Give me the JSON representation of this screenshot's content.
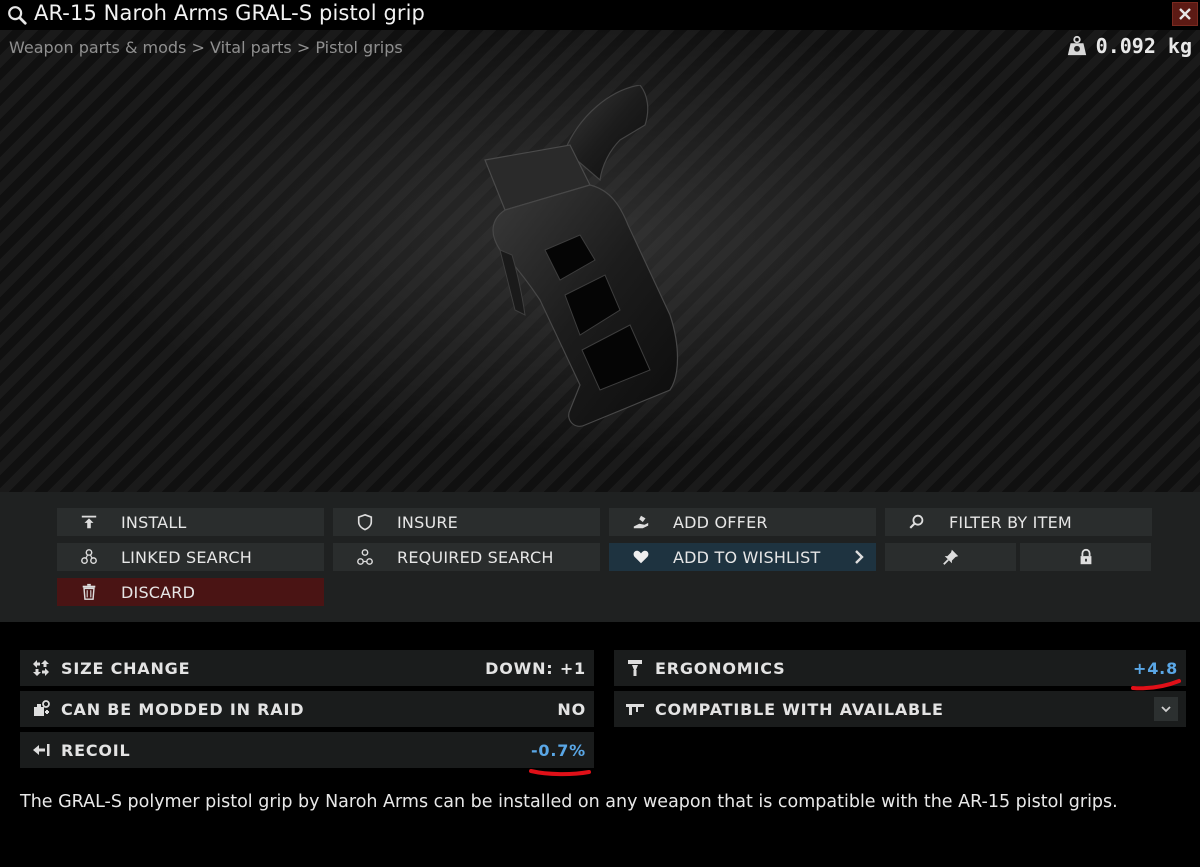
{
  "window": {
    "title": "AR-15 Naroh Arms GRAL-S pistol grip",
    "icons": {
      "search": "search-icon",
      "close": "close-icon"
    }
  },
  "breadcrumb": {
    "items": [
      "Weapon parts & mods",
      "Vital parts",
      "Pistol grips"
    ],
    "separator": ">"
  },
  "weight": {
    "value": "0.092 kg",
    "icon": "weight-icon"
  },
  "preview": {
    "image": "pistol-grip-image"
  },
  "actions": {
    "install": "INSTALL",
    "insure": "INSURE",
    "add_offer": "ADD OFFER",
    "filter_by_item": "FILTER BY ITEM",
    "linked_search": "LINKED SEARCH",
    "required_search": "REQUIRED SEARCH",
    "add_to_wishlist": "ADD TO WISHLIST",
    "pin": "pin-icon",
    "lock": "lock-icon",
    "discard": "DISCARD"
  },
  "stats": {
    "size_change": {
      "label": "SIZE CHANGE",
      "value": "DOWN: +1"
    },
    "modded_in_raid": {
      "label": "CAN BE MODDED IN RAID",
      "value": "NO"
    },
    "recoil": {
      "label": "RECOIL",
      "value": "-0.7%"
    },
    "ergonomics": {
      "label": "ERGONOMICS",
      "value": "+4.8"
    },
    "compatible": {
      "label": "COMPATIBLE WITH AVAILABLE"
    }
  },
  "description": "The GRAL-S polymer pistol grip by Naroh Arms can be installed on any weapon that is compatible with the AR-15 pistol grips.",
  "colors": {
    "accent_blue": "#5aa7e6",
    "annotation_red": "#e01018",
    "discard_red": "#4a1414",
    "wishlist_blue": "#1e3340"
  }
}
